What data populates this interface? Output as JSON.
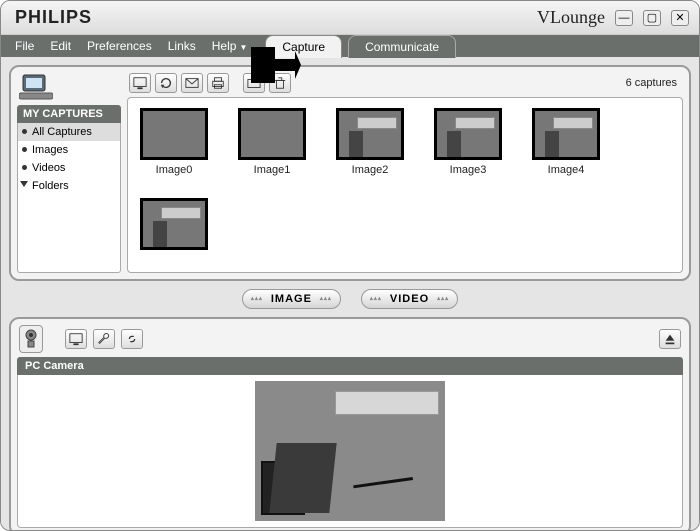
{
  "titlebar": {
    "brand": "PHILIPS",
    "appname": "VLounge"
  },
  "menu": {
    "file": "File",
    "edit": "Edit",
    "prefs": "Preferences",
    "links": "Links",
    "help": "Help"
  },
  "tabs": {
    "capture": "Capture",
    "communicate": "Communicate"
  },
  "sidebar": {
    "heading": "MY CAPTURES",
    "items": [
      {
        "label": "All Captures"
      },
      {
        "label": "Images"
      },
      {
        "label": "Videos"
      },
      {
        "label": "Folders"
      }
    ]
  },
  "grid": {
    "count_label": "6 captures",
    "thumbs": [
      {
        "label": "Image0"
      },
      {
        "label": "Image1"
      },
      {
        "label": "Image2"
      },
      {
        "label": "Image3"
      },
      {
        "label": "Image4"
      },
      {
        "label": ""
      }
    ]
  },
  "toggle": {
    "image": "IMAGE",
    "video": "VIDEO"
  },
  "camera": {
    "heading": "PC Camera"
  }
}
